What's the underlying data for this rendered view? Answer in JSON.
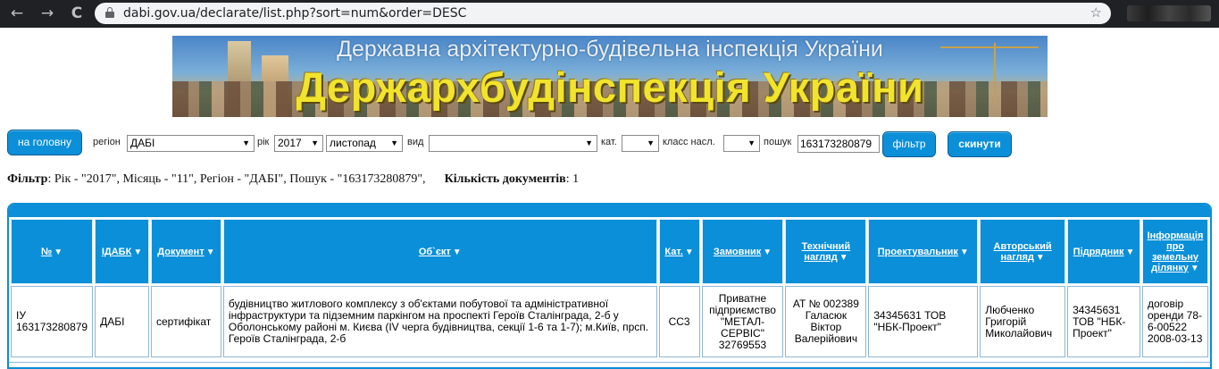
{
  "browser": {
    "url": "dabi.gov.ua/declarate/list.php?sort=num&order=DESC",
    "back": "←",
    "forward": "→",
    "reload": "C",
    "star": "☆"
  },
  "banner": {
    "subtitle": "Державна архітектурно-будівельна інспекція України",
    "title": "Держархбудінспекція України"
  },
  "toolbar": {
    "home_label": "на головну",
    "region_label": "регіон",
    "region_value": "ДАБІ",
    "year_label": "рік",
    "year_value": "2017",
    "month_value": "листопад",
    "kind_label": "вид",
    "kind_value": "",
    "cat_label": "кат.",
    "cat_value": "",
    "class_label": "класс насл.",
    "class_value": "",
    "search_label": "пошук",
    "search_value": "163173280879",
    "filter_label": "фільтр",
    "reset_label": "скинути"
  },
  "summary": {
    "filter_label": "Фільтр",
    "filter_text": ": Рік - \"2017\", Місяць - \"11\", Регіон - \"ДАБІ\", Пошук - \"163173280879\",",
    "count_label": "Кількість документів",
    "count_value": ": 1"
  },
  "table": {
    "headers": [
      "№",
      "ІДАБК",
      "Документ",
      "Об`єкт",
      "Кат.",
      "Замовник",
      "Технічний нагляд",
      "Проектувальник",
      "Авторський нагляд",
      "Підрядник",
      "Інформація про земельну ділянку"
    ],
    "rows": [
      [
        "ІУ 163173280879",
        "ДАБІ",
        "сертифікат",
        "будівництво житлового комплексу з об'єктами побутової та адміністративної інфраструктури та підземним паркінгом на проспекті Героїв Сталінграда, 2-б у Оболонському районі м. Києва (IV черга будівництва, секції 1-6 та 1-7); м.Київ, прсп. Героїв Сталінграда, 2-б",
        "СС3",
        "Приватне підприємство \"МЕТАЛ-СЕРВІС\" 32769553",
        "АТ № 002389 Галасюк Віктор Валерійович",
        "34345631 ТОВ \"НБК-Проект\"",
        "Любченко Григорій Миколайович",
        "34345631 ТОВ \"НБК-Проект\"",
        "договір оренди 78-6-00522 2008-03-13"
      ]
    ]
  }
}
